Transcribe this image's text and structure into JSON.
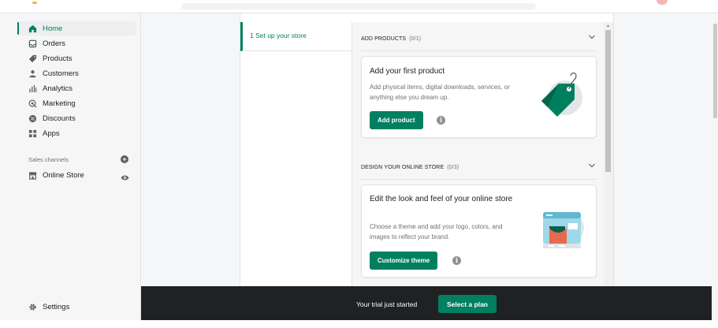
{
  "sidebar": {
    "items": [
      {
        "label": "Home",
        "icon": "home-icon",
        "active": true
      },
      {
        "label": "Orders",
        "icon": "orders-icon"
      },
      {
        "label": "Products",
        "icon": "tag-icon"
      },
      {
        "label": "Customers",
        "icon": "person-icon"
      },
      {
        "label": "Analytics",
        "icon": "bar-chart-icon"
      },
      {
        "label": "Marketing",
        "icon": "target-icon"
      },
      {
        "label": "Discounts",
        "icon": "discount-icon"
      },
      {
        "label": "Apps",
        "icon": "apps-icon"
      }
    ],
    "sales_channels_label": "Sales channels",
    "online_store_label": "Online Store",
    "settings_label": "Settings"
  },
  "setup": {
    "step_tab_label": "1 Set up your store",
    "groups": [
      {
        "title": "ADD PRODUCTS",
        "count": "(0/1)",
        "card_title": "Add your first product",
        "card_text": "Add physical items, digital downloads, services, or anything else you dream up.",
        "button_label": "Add product"
      },
      {
        "title": "DESIGN YOUR ONLINE STORE",
        "count": "(0/3)",
        "card_title": "Edit the look and feel of your online store",
        "card_text": "Choose a theme and add your logo, colors, and images to reflect your brand.",
        "button_label": "Customize theme"
      }
    ]
  },
  "trial_bar": {
    "message": "Your trial just started",
    "button_label": "Select a plan"
  },
  "colors": {
    "accent": "#008060",
    "bottom_bar": "#202123"
  }
}
